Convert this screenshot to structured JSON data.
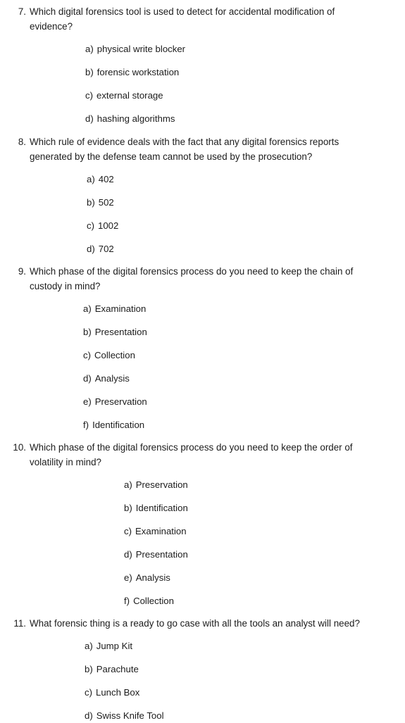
{
  "document": {
    "type": "quiz-worksheet",
    "subject": "Digital Forensics",
    "text_color": "#1c1c1c",
    "background_color": "#ffffff"
  },
  "questions": [
    {
      "number": "7.",
      "text": "Which digital forensics tool is used to detect for accidental modification of evidence?",
      "options": [
        {
          "letter": "a)",
          "text": "physical write blocker"
        },
        {
          "letter": "b)",
          "text": "forensic workstation"
        },
        {
          "letter": "c)",
          "text": "external storage"
        },
        {
          "letter": "d)",
          "text": "hashing algorithms"
        }
      ]
    },
    {
      "number": "8.",
      "text": "Which rule of evidence deals with the fact that any digital forensics reports generated by the defense team cannot be used by the prosecution?",
      "options": [
        {
          "letter": "a)",
          "text": "402"
        },
        {
          "letter": "b)",
          "text": "502"
        },
        {
          "letter": "c)",
          "text": "1002"
        },
        {
          "letter": "d)",
          "text": "702"
        }
      ]
    },
    {
      "number": "9.",
      "text": "Which phase of the digital forensics process do you need to keep the chain of custody in mind?",
      "options": [
        {
          "letter": "a)",
          "text": "Examination"
        },
        {
          "letter": "b)",
          "text": "Presentation"
        },
        {
          "letter": "c)",
          "text": "Collection"
        },
        {
          "letter": "d)",
          "text": "Analysis"
        },
        {
          "letter": "e)",
          "text": "Preservation"
        },
        {
          "letter": "f)",
          "text": "Identification"
        }
      ]
    },
    {
      "number": "10.",
      "text": "Which phase of the digital forensics process do you need to keep the order of volatility in mind?",
      "options": [
        {
          "letter": "a)",
          "text": "Preservation"
        },
        {
          "letter": "b)",
          "text": "Identification"
        },
        {
          "letter": "c)",
          "text": "Examination"
        },
        {
          "letter": "d)",
          "text": "Presentation"
        },
        {
          "letter": "e)",
          "text": "Analysis"
        },
        {
          "letter": "f)",
          "text": "Collection"
        }
      ]
    },
    {
      "number": "11.",
      "text": "What forensic thing is a ready to go case with all the tools an analyst will need?",
      "options": [
        {
          "letter": "a)",
          "text": "Jump Kit"
        },
        {
          "letter": "b)",
          "text": "Parachute"
        },
        {
          "letter": "c)",
          "text": "Lunch Box"
        },
        {
          "letter": "d)",
          "text": "Swiss Knife Tool"
        }
      ]
    }
  ]
}
